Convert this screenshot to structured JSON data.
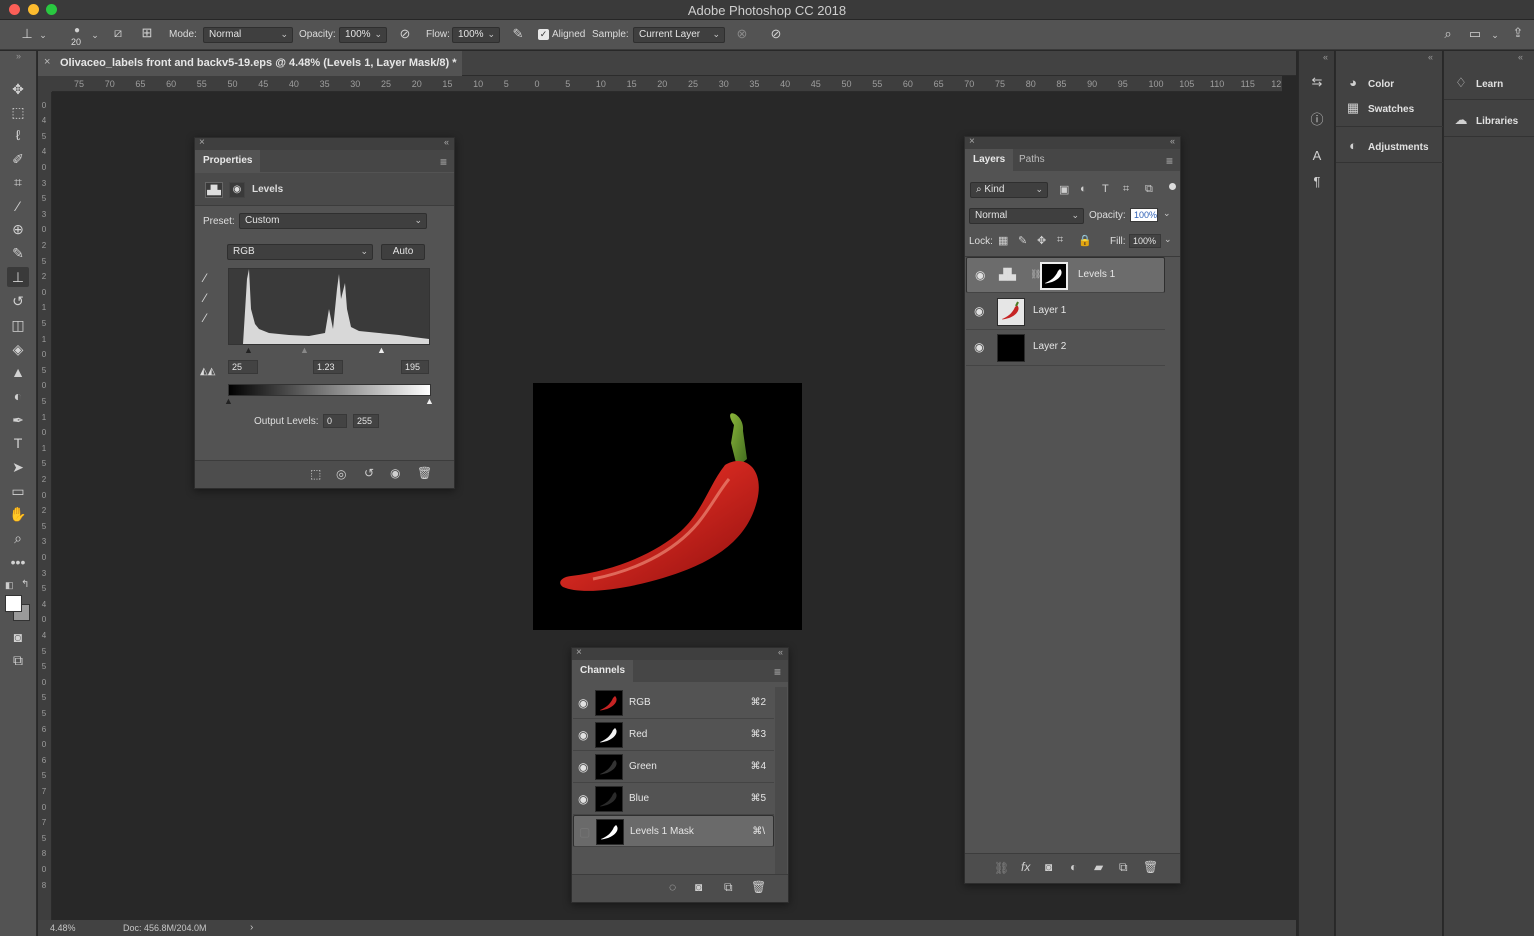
{
  "app": {
    "title": "Adobe Photoshop CC 2018"
  },
  "options_bar": {
    "brush_size": "20",
    "mode_label": "Mode:",
    "mode_value": "Normal",
    "opacity_label": "Opacity:",
    "opacity_value": "100%",
    "flow_label": "Flow:",
    "flow_value": "100%",
    "aligned_label": "Aligned",
    "sample_label": "Sample:",
    "sample_value": "Current Layer"
  },
  "document": {
    "tab_title": "Olivaceo_labels front and backv5-19.eps @ 4.48% (Levels 1, Layer Mask/8) *",
    "zoom": "4.48%",
    "doc_size": "Doc: 456.8M/204.0M"
  },
  "rulers": {
    "horizontal": [
      "75",
      "70",
      "65",
      "60",
      "55",
      "50",
      "45",
      "40",
      "35",
      "30",
      "25",
      "20",
      "15",
      "10",
      "5",
      "0",
      "5",
      "10",
      "15",
      "20",
      "25",
      "30",
      "35",
      "40",
      "45",
      "50",
      "55",
      "60",
      "65",
      "70",
      "75",
      "80",
      "85",
      "90",
      "95",
      "100",
      "105",
      "110",
      "115",
      "12"
    ],
    "vertical": [
      "5",
      "0",
      "4",
      "5",
      "4",
      "0",
      "3",
      "5",
      "3",
      "0",
      "2",
      "5",
      "2",
      "0",
      "1",
      "5",
      "1",
      "0",
      "5",
      "0",
      "5",
      "1",
      "0",
      "1",
      "5",
      "2",
      "0",
      "2",
      "5",
      "3",
      "0",
      "3",
      "5",
      "4",
      "0",
      "4",
      "5",
      "5",
      "0",
      "5",
      "5",
      "6",
      "0",
      "6",
      "5",
      "7",
      "0",
      "7",
      "5",
      "8",
      "0",
      "8"
    ]
  },
  "properties_panel": {
    "tab": "Properties",
    "adjustment_name": "Levels",
    "preset_label": "Preset:",
    "preset_value": "Custom",
    "channel_value": "RGB",
    "auto_label": "Auto",
    "input_black": "25",
    "input_gamma": "1.23",
    "input_white": "195",
    "output_label": "Output Levels:",
    "output_black": "0",
    "output_white": "255"
  },
  "layers_panel": {
    "tabs": [
      "Layers",
      "Paths"
    ],
    "filter_value": "Kind",
    "blend_mode": "Normal",
    "opacity_label": "Opacity:",
    "opacity_value": "100%",
    "lock_label": "Lock:",
    "fill_label": "Fill:",
    "fill_value": "100%",
    "layers": [
      {
        "name": "Levels 1"
      },
      {
        "name": "Layer 1"
      },
      {
        "name": "Layer 2"
      }
    ]
  },
  "channels_panel": {
    "tab": "Channels",
    "channels": [
      {
        "name": "RGB",
        "shortcut": "⌘2"
      },
      {
        "name": "Red",
        "shortcut": "⌘3"
      },
      {
        "name": "Green",
        "shortcut": "⌘4"
      },
      {
        "name": "Blue",
        "shortcut": "⌘5"
      },
      {
        "name": "Levels 1 Mask",
        "shortcut": "⌘\\"
      }
    ]
  },
  "dock": {
    "group1": [
      "Color",
      "Swatches",
      "Adjustments"
    ],
    "group2": [
      "Learn",
      "Libraries"
    ]
  },
  "colors": {
    "app_bg": "#282828",
    "panel_bg": "#535353",
    "pepper_red": "#c62424",
    "stem_green": "#4c7a24"
  }
}
